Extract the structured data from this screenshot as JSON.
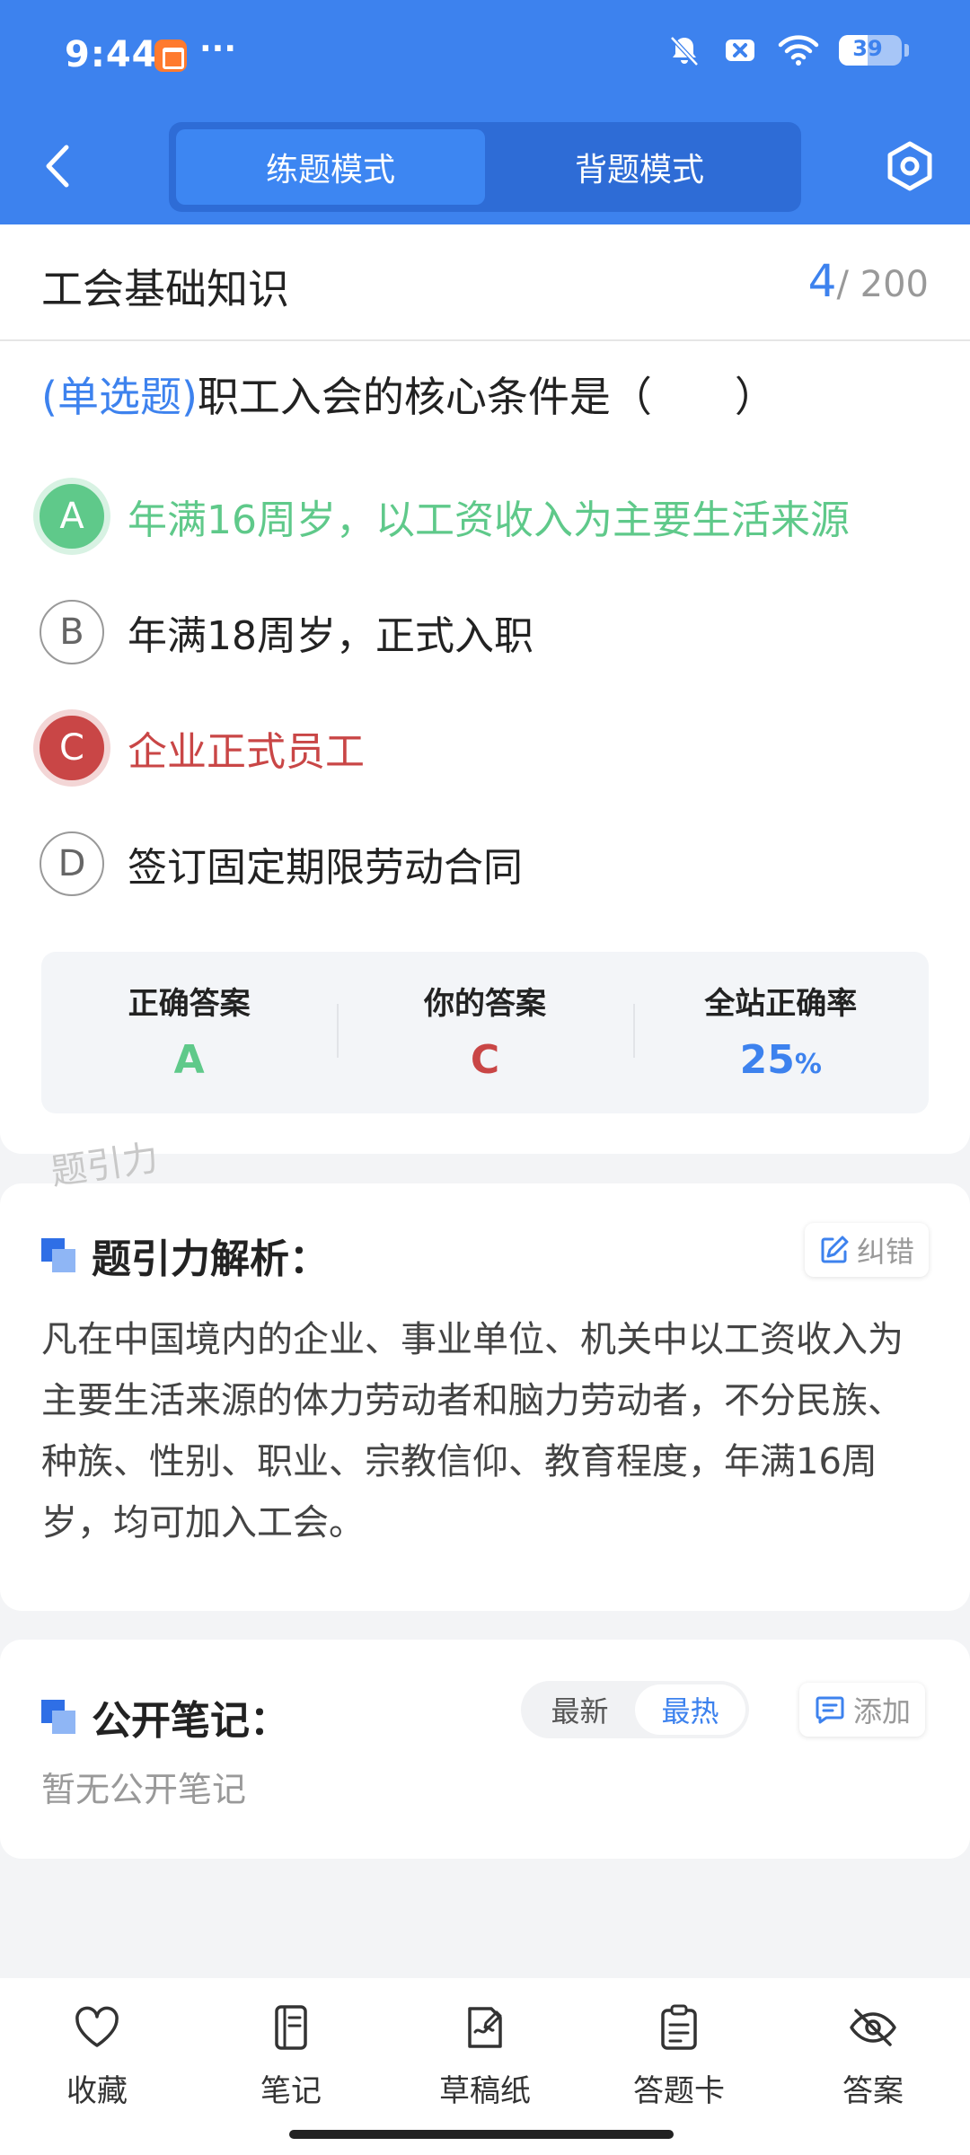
{
  "status_bar": {
    "time": "9:44",
    "dots": "···",
    "battery": "39"
  },
  "nav": {
    "modes": [
      "练题模式",
      "背题模式"
    ],
    "active_mode": 0
  },
  "question": {
    "subject": "工会基础知识",
    "current": "4",
    "total": "/ 200",
    "type_tag": "(单选题)",
    "stem": "职工入会的核心条件是（　　）",
    "options": [
      {
        "letter": "A",
        "text": "年满16周岁，以工资收入为主要生活来源",
        "state": "correct"
      },
      {
        "letter": "B",
        "text": "年满18周岁，正式入职",
        "state": "normal"
      },
      {
        "letter": "C",
        "text": "企业正式员工",
        "state": "wrong"
      },
      {
        "letter": "D",
        "text": "签订固定期限劳动合同",
        "state": "normal"
      }
    ]
  },
  "answer_summary": {
    "correct_label": "正确答案",
    "correct_value": "A",
    "yours_label": "你的答案",
    "yours_value": "C",
    "rate_label": "全站正确率",
    "rate_value": "25",
    "rate_unit": "%"
  },
  "watermark": "题引力",
  "analysis": {
    "title": "题引力解析：",
    "report_button": "纠错",
    "text": "凡在中国境内的企业、事业单位、机关中以工资收入为主要生活来源的体力劳动者和脑力劳动者，不分民族、种族、性别、职业、宗教信仰、教育程度，年满16周岁，均可加入工会。"
  },
  "notes": {
    "title": "公开笔记：",
    "sort_options": [
      "最新",
      "最热"
    ],
    "active_sort": 1,
    "add_button": "添加",
    "empty_text": "暂无公开笔记"
  },
  "toolbar": {
    "items": [
      {
        "label": "收藏",
        "icon": "heart-icon"
      },
      {
        "label": "笔记",
        "icon": "notebook-icon"
      },
      {
        "label": "草稿纸",
        "icon": "draft-paper-icon"
      },
      {
        "label": "答题卡",
        "icon": "answer-sheet-icon"
      },
      {
        "label": "答案",
        "icon": "eye-off-icon"
      }
    ]
  },
  "colors": {
    "primary": "#3d82ee",
    "correct": "#5fc98a",
    "wrong": "#c94646"
  }
}
